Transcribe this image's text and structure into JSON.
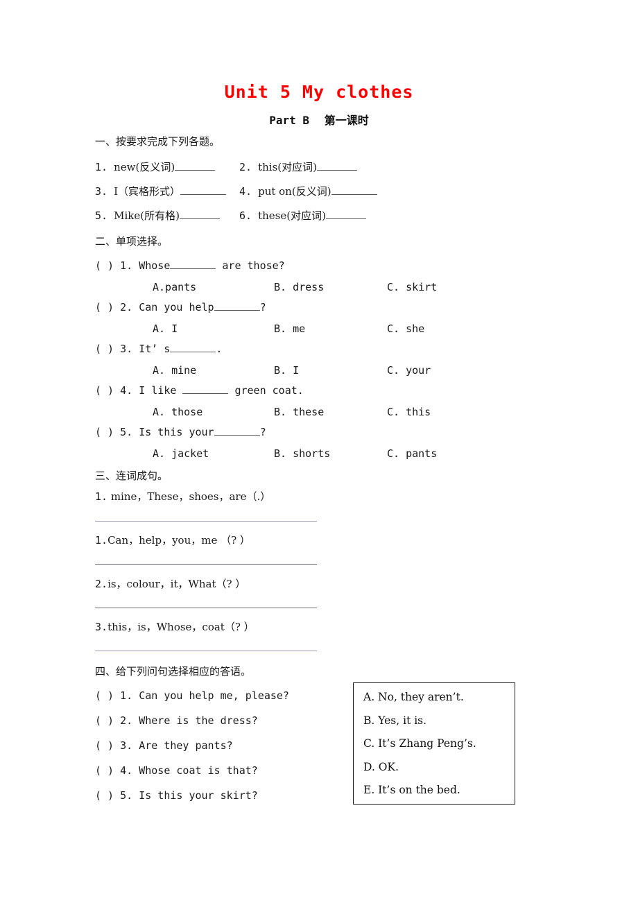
{
  "title": "Unit 5   My clothes",
  "subtitle_en": "Part B",
  "subtitle_cn": "第一课时",
  "title_color": "#ff0000",
  "section1": {
    "heading": "一、按要求完成下列各题。",
    "items": [
      {
        "num": "1.",
        "text": "new(反义词)"
      },
      {
        "num": "2.",
        "text": "this(对应词)"
      },
      {
        "num": "3.",
        "text": "I（宾格形式）"
      },
      {
        "num": "4.",
        "text": "put on(反义词)"
      },
      {
        "num": "5.",
        "text": "Mike(所有格)"
      },
      {
        "num": "6.",
        "text": "these(对应词)"
      }
    ]
  },
  "section2": {
    "heading": "二、单项选择。",
    "questions": [
      {
        "bracket": "(      )",
        "num": "1.",
        "stem_before": "Whose",
        "stem_after": " are those?",
        "options": [
          "A.pants",
          "B. dress",
          "C. skirt"
        ]
      },
      {
        "bracket": "(      )",
        "num": "2.",
        "stem_before": "Can you help",
        "stem_after": "?",
        "options": [
          "A. I",
          "B. me",
          "C. she"
        ]
      },
      {
        "bracket": "(      )",
        "num": "3.",
        "stem_before": "It’ s",
        "stem_after": ".",
        "options": [
          "A. mine",
          "B. I",
          "C. your"
        ]
      },
      {
        "bracket": "(      )",
        "num": "4.",
        "stem_before": "I like ",
        "stem_after": " green coat.",
        "options": [
          "A. those",
          "B. these",
          "C. this"
        ]
      },
      {
        "bracket": "(      )",
        "num": "5.",
        "stem_before": "Is this your",
        "stem_after": "?",
        "options": [
          "A. jacket",
          "B. shorts",
          "C. pants"
        ]
      }
    ]
  },
  "section3": {
    "heading": "三、连词成句。",
    "items": [
      {
        "num": "1.",
        "text": " mine，These，shoes，are（.）"
      },
      {
        "num": "1.",
        "text": "Can，help，you，me （? ）"
      },
      {
        "num": "2.",
        "text": "is，colour，it，What（? ）"
      },
      {
        "num": "3.",
        "text": "this，is，Whose，coat（? ）"
      }
    ]
  },
  "section4": {
    "heading": "四、给下列问句选择相应的答语。",
    "questions": [
      {
        "bracket": "(      )",
        "num": "1.",
        "text": "Can you help me, please?"
      },
      {
        "bracket": "(      )",
        "num": "2.",
        "text": "Where is the dress?"
      },
      {
        "bracket": "(      )",
        "num": "3.",
        "text": "Are they pants?"
      },
      {
        "bracket": "(      )",
        "num": "4.",
        "text": "Whose coat is that?"
      },
      {
        "bracket": "(      )",
        "num": "5.",
        "text": "Is this your skirt?"
      }
    ],
    "answer_choices": [
      "A. No, they aren’t.",
      "B. Yes, it is.",
      "C. It’s Zhang Peng’s.",
      "D. OK.",
      "E. It’s on the bed."
    ]
  }
}
